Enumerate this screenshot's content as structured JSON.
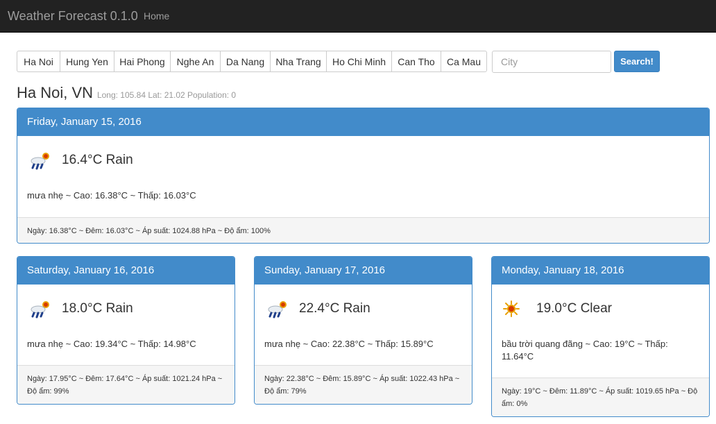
{
  "navbar": {
    "brand": "Weather Forecast 0.1.0",
    "home": "Home"
  },
  "cities": [
    "Ha Noi",
    "Hung Yen",
    "Hai Phong",
    "Nghe An",
    "Da Nang",
    "Nha Trang",
    "Ho Chi Minh",
    "Can Tho",
    "Ca Mau"
  ],
  "search": {
    "placeholder": "City",
    "button": "Search!"
  },
  "location": {
    "name": "Ha Noi, VN",
    "meta": "Long: 105.84 Lat: 21.02 Population: 0"
  },
  "days": [
    {
      "date": "Friday, January 15, 2016",
      "icon": "rain-sun-icon",
      "temp": "16.4°C Rain",
      "desc": "mưa nhẹ ~  Cao: 16.38°C ~  Thấp: 16.03°C",
      "footer": "Ngày: 16.38°C ~  Đêm: 16.03°C ~  Áp suất: 1024.88 hPa ~  Độ ẩm: 100%"
    },
    {
      "date": "Saturday, January 16, 2016",
      "icon": "rain-sun-icon",
      "temp": "18.0°C Rain",
      "desc": "mưa nhẹ ~  Cao: 19.34°C ~  Thấp: 14.98°C",
      "footer": "Ngày: 17.95°C ~  Đêm: 17.64°C ~  Áp suất: 1021.24 hPa ~  Độ ẩm: 99%"
    },
    {
      "date": "Sunday, January 17, 2016",
      "icon": "rain-sun-icon",
      "temp": "22.4°C Rain",
      "desc": "mưa nhẹ ~  Cao: 22.38°C ~  Thấp: 15.89°C",
      "footer": "Ngày: 22.38°C ~  Đêm: 15.89°C ~  Áp suất: 1022.43 hPa ~  Độ ẩm: 79%"
    },
    {
      "date": "Monday, January 18, 2016",
      "icon": "sun-icon",
      "temp": "19.0°C Clear",
      "desc": "bầu trời quang đãng ~  Cao: 19°C ~  Thấp: 11.64°C",
      "footer": "Ngày: 19°C ~  Đêm: 11.89°C ~  Áp suất: 1019.65 hPa ~  Độ ẩm: 0%"
    }
  ],
  "colors": {
    "primary": "#428bca",
    "navbar": "#222222"
  }
}
